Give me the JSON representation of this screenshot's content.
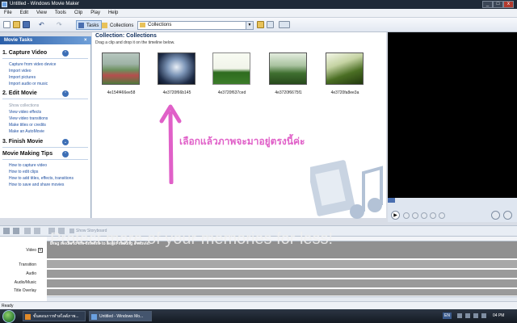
{
  "window": {
    "title": "Untitled - Windows Movie Maker"
  },
  "menu": [
    "File",
    "Edit",
    "View",
    "Tools",
    "Clip",
    "Play",
    "Help"
  ],
  "toolbar": {
    "tasks_label": "Tasks",
    "collections_label": "Collections",
    "collection_selected": "Collections"
  },
  "tasks_pane": {
    "header": "Movie Tasks",
    "sections": [
      {
        "number_title": "1. Capture Video",
        "items": [
          "Capture from video device",
          "Import video",
          "Import pictures",
          "Import audio or music"
        ]
      },
      {
        "number_title": "2. Edit Movie",
        "items": [
          "Show collections",
          "View video effects",
          "View video transitions",
          "Make titles or credits",
          "Make an AutoMovie"
        ]
      },
      {
        "number_title": "3. Finish Movie",
        "items": []
      },
      {
        "number_title": "Movie Making Tips",
        "items": [
          "How to capture video",
          "How to edit clips",
          "How to add titles, effects, transitions",
          "How to save and share movies"
        ]
      }
    ]
  },
  "collection": {
    "title": "Collection: Collections",
    "subtitle": "Drag a clip and drop it on the timeline below.",
    "clips": [
      {
        "label": "4e154f466ee58"
      },
      {
        "label": "4e3720f66b145"
      },
      {
        "label": "4e3720f637ced"
      },
      {
        "label": "4e3720f6675f1"
      },
      {
        "label": "4e3720fa8ee3a"
      }
    ],
    "annotation": "เลือกแล้วภาพจะมาอยู่ตรงนี้ค่ะ",
    "watermark_fragment": "et"
  },
  "storyboard": {
    "show_label": "Show Storyboard"
  },
  "timeline": {
    "drag_hint": "Drag media to the timeline to begin making a movie.",
    "tracks": [
      "Video",
      "Transition",
      "Audio",
      "Audio/Music",
      "Title Overlay"
    ]
  },
  "promo_watermark": "Protect more of your memories for less!",
  "status": "Ready",
  "taskbar": {
    "apps": [
      "ขั้นตอนการทำสไลด์ภาพ...",
      "Untitled - Windows Mo..."
    ],
    "lang": "EN",
    "time": "04 PM"
  }
}
